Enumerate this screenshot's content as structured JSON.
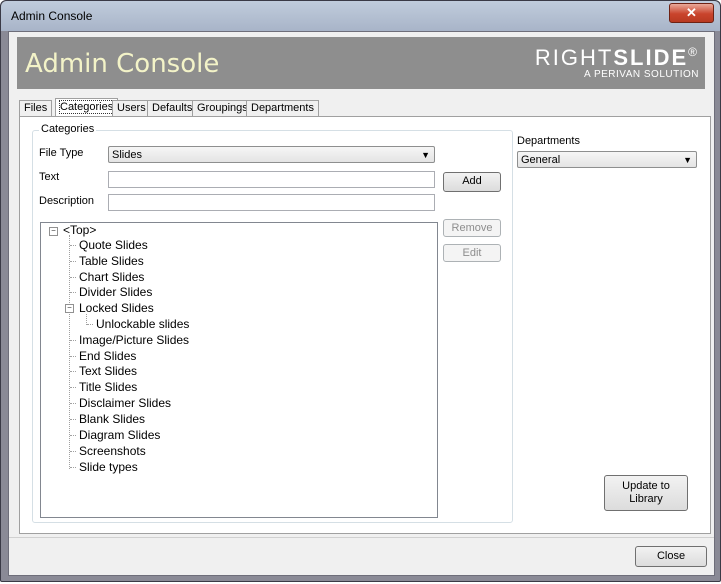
{
  "window": {
    "title": "Admin Console",
    "close_glyph": "✕"
  },
  "banner": {
    "title": "Admin Console",
    "logo_light": "RIGHT",
    "logo_bold": "SLIDE",
    "logo_reg": "®",
    "logo_sub": "A PERIVAN SOLUTION"
  },
  "tabs": [
    "Files",
    "Categories",
    "Users",
    "Defaults",
    "Groupings",
    "Departments"
  ],
  "categories": {
    "group_title": "Categories",
    "file_type_label": "File Type",
    "file_type_value": "Slides",
    "text_label": "Text",
    "text_value": "",
    "description_label": "Description",
    "description_value": "",
    "add_label": "Add",
    "remove_label": "Remove",
    "edit_label": "Edit"
  },
  "tree": {
    "root": "<Top>",
    "items": [
      "Quote Slides",
      "Table Slides",
      "Chart Slides",
      "Divider Slides",
      "Locked Slides",
      "Unlockable slides",
      "Image/Picture Slides",
      "End Slides",
      "Text Slides",
      "Title Slides",
      "Disclaimer Slides",
      "Blank Slides",
      "Diagram Slides",
      "Screenshots",
      "Slide types"
    ]
  },
  "departments": {
    "label": "Departments",
    "value": "General"
  },
  "update_label": "Update to Library",
  "close_label": "Close"
}
